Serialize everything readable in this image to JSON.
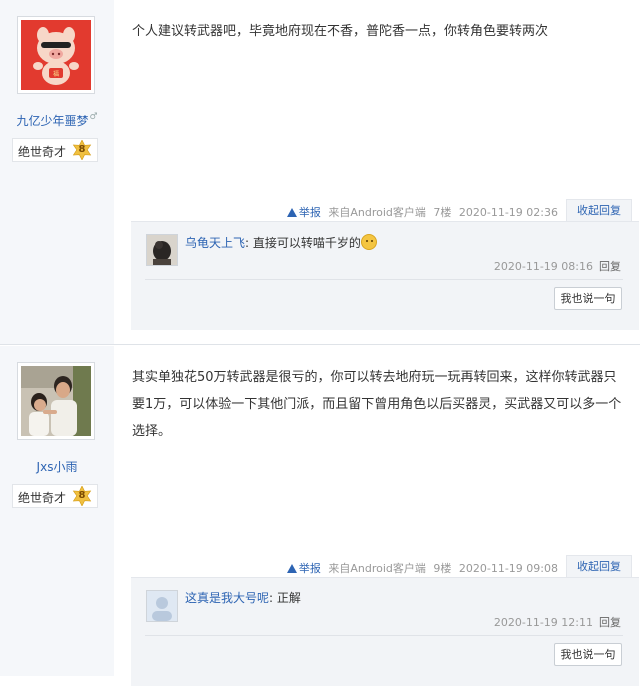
{
  "posts": [
    {
      "author": {
        "name": "九亿少年噩梦",
        "gender_mark": "♂",
        "level_title": "绝世奇才",
        "level_number": "8",
        "avatar": "pig-mascot-avatar"
      },
      "content": "个人建议转武器吧，毕竟地府现在不香，普陀香一点，你转角色要转两次",
      "meta": {
        "report_label": "举报",
        "source": "来自Android客户端",
        "floor": "7楼",
        "time": "2020-11-19 02:36"
      },
      "collapse_label": "收起回复",
      "replies": [
        {
          "name": "乌龟天上飞",
          "separator": ":",
          "text": "直接可以转喵千岁的",
          "has_emoji": true,
          "time": "2020-11-19 08:16",
          "reply_label": "回复"
        }
      ],
      "say_label": "我也说一句"
    },
    {
      "author": {
        "name": "Jxs小雨",
        "level_title": "绝世奇才",
        "level_number": "8",
        "avatar": "photo-avatar"
      },
      "content": "其实单独花50万转武器是很亏的，你可以转去地府玩一玩再转回来，这样你转武器只要1万，可以体验一下其他门派，而且留下曾用角色以后买器灵，买武器又可以多一个选择。",
      "meta": {
        "report_label": "举报",
        "source": "来自Android客户端",
        "floor": "9楼",
        "time": "2020-11-19 09:08"
      },
      "collapse_label": "收起回复",
      "replies": [
        {
          "name": "这真是我大号呢",
          "separator": ":",
          "text": "正解",
          "has_emoji": false,
          "time": "2020-11-19 12:11",
          "reply_label": "回复"
        }
      ],
      "say_label": "我也说一句"
    }
  ],
  "colors": {
    "link": "#2d64b3",
    "sidebar_bg": "#f5f7fa",
    "reply_bg": "#f2f4f7",
    "badge_gold": "#f0c040"
  }
}
